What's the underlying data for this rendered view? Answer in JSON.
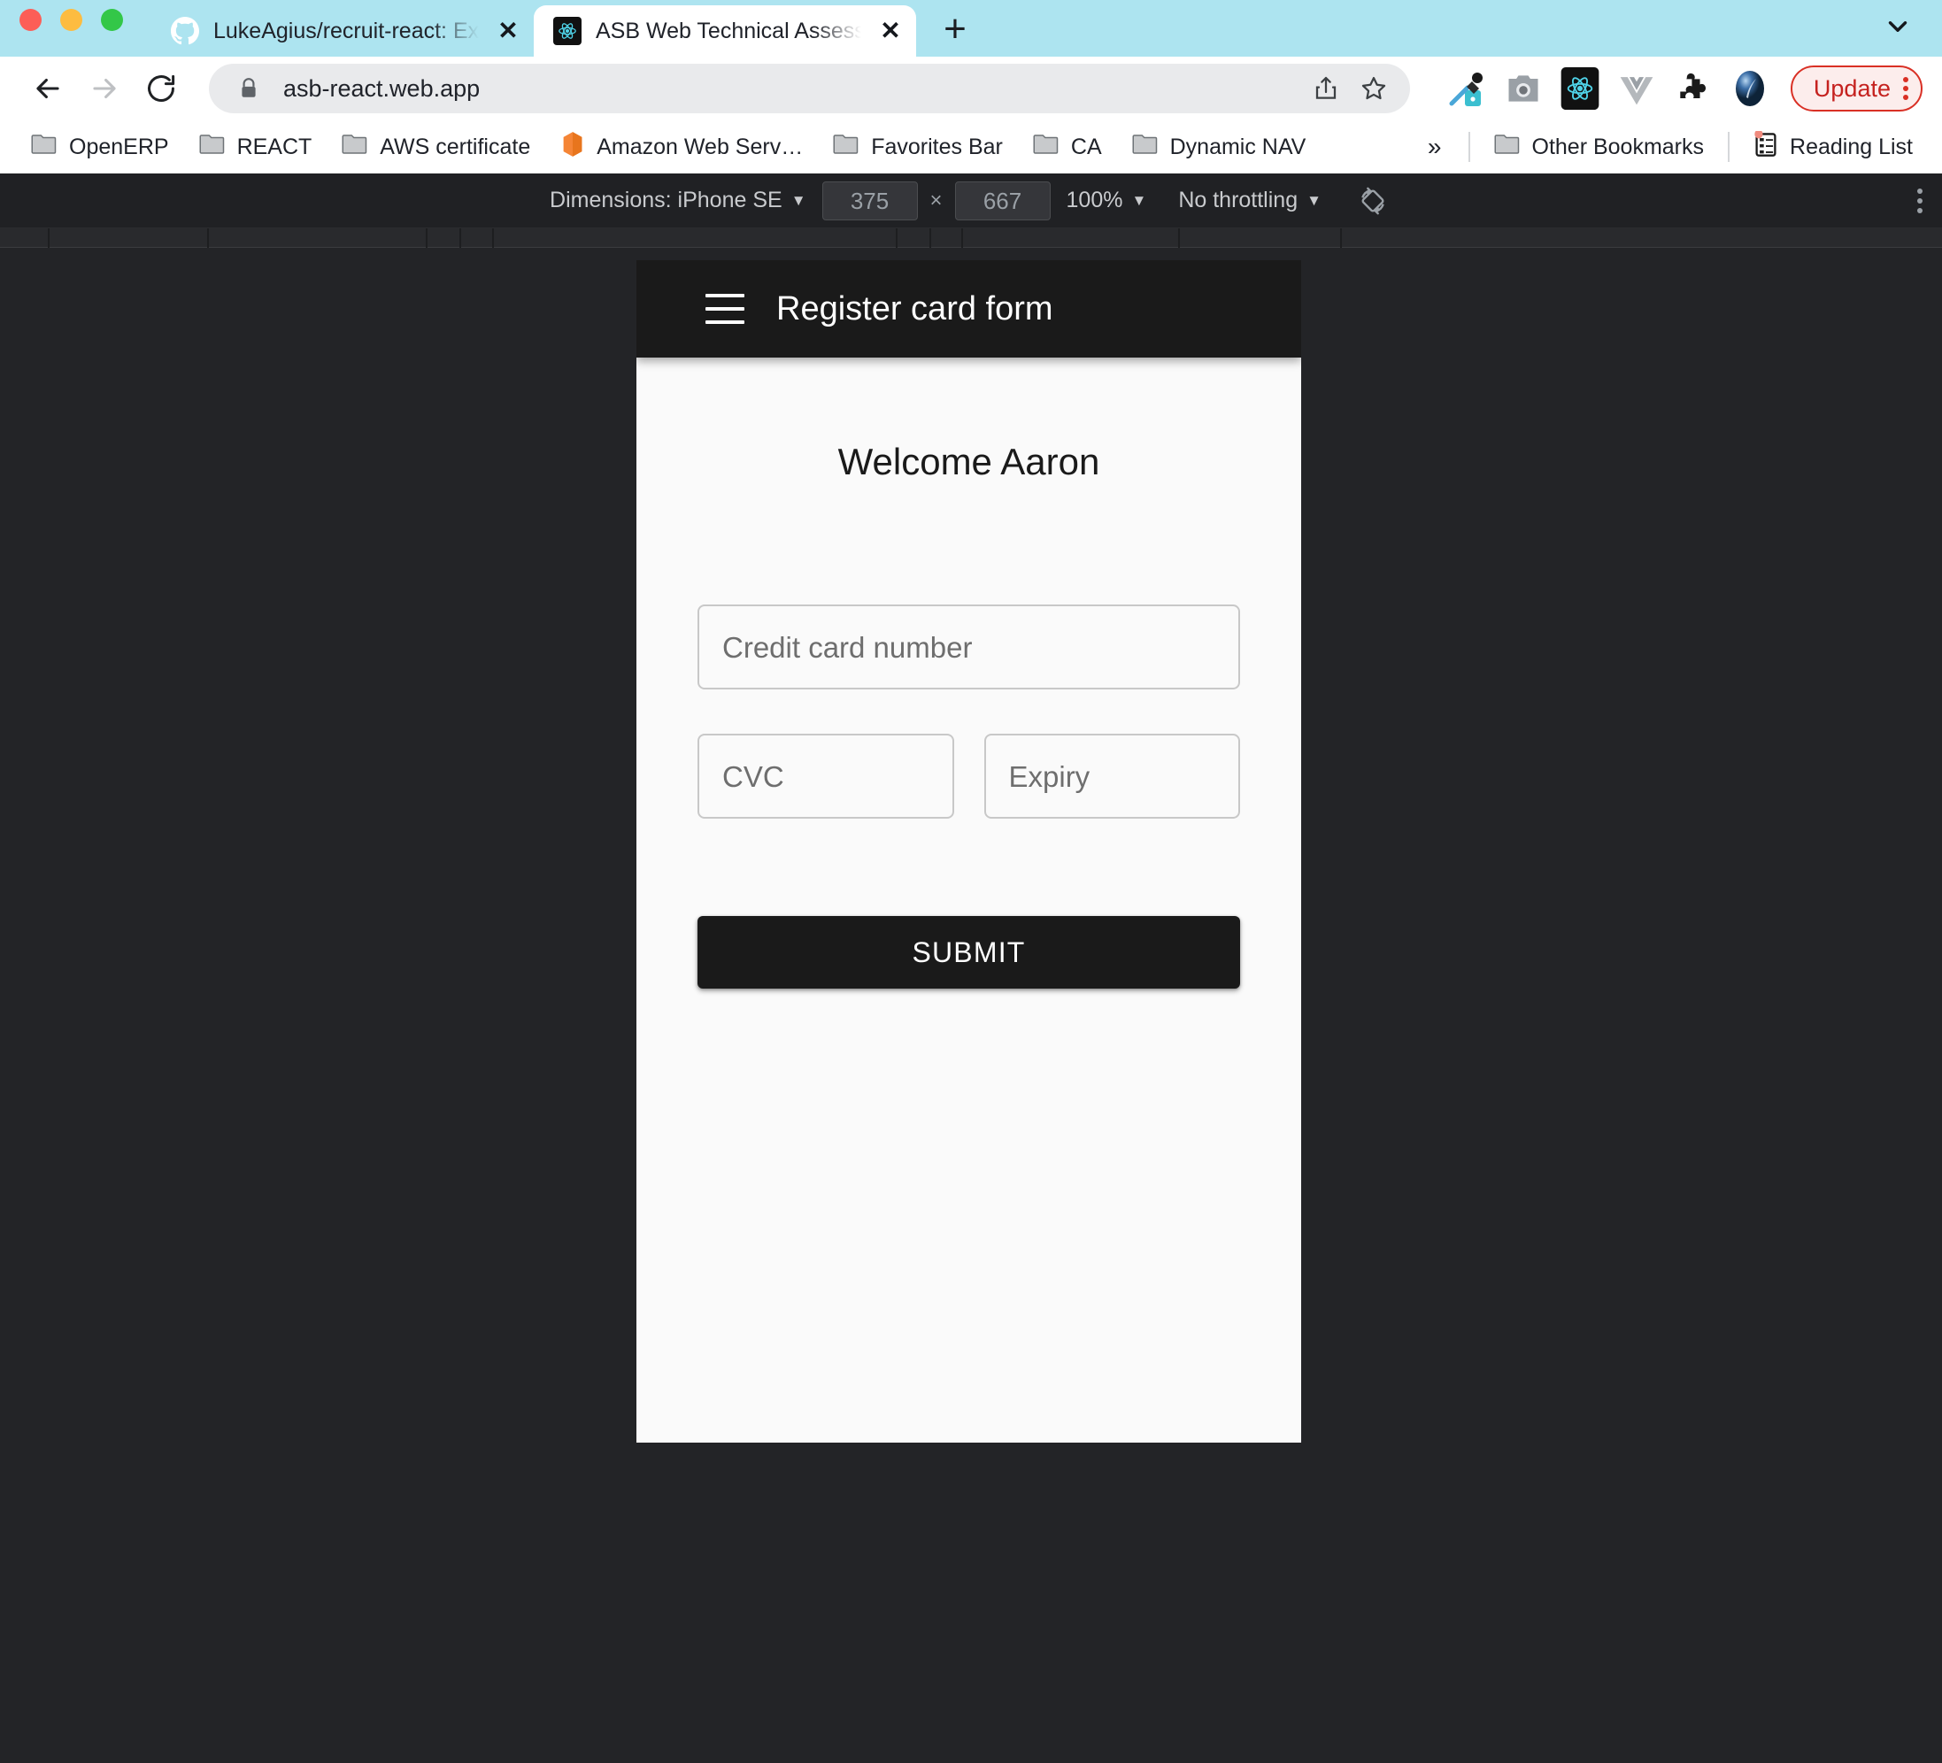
{
  "browser": {
    "window_controls": [
      "close",
      "minimize",
      "maximize"
    ],
    "tabs": [
      {
        "title": "LukeAgius/recruit-react: Examp",
        "favicon": "github-icon",
        "active": false,
        "close_label": "✕"
      },
      {
        "title": "ASB Web Technical Assessmen",
        "favicon": "react-icon",
        "active": true,
        "close_label": "✕"
      }
    ],
    "new_tab_label": "+",
    "tab_list_chevron": "chevron-down-icon",
    "omnibox": {
      "url": "asb-react.web.app",
      "lock_icon": "lock-icon",
      "share_icon": "share-icon",
      "bookmark_icon": "star-icon"
    },
    "extensions": [
      "eyedropper-icon",
      "camera-icon",
      "react-devtools-icon",
      "vue-devtools-icon",
      "puzzle-piece-icon",
      "profile-avatar-icon"
    ],
    "update_button": {
      "label": "Update",
      "color": "#D93025"
    },
    "bookmarks": [
      {
        "label": "OpenERP",
        "icon": "folder-icon"
      },
      {
        "label": "REACT",
        "icon": "folder-icon"
      },
      {
        "label": "AWS certificate",
        "icon": "folder-icon"
      },
      {
        "label": "Amazon Web Serv…",
        "icon": "aws-icon"
      },
      {
        "label": "Favorites Bar",
        "icon": "folder-icon"
      },
      {
        "label": "CA",
        "icon": "folder-icon"
      },
      {
        "label": "Dynamic NAV",
        "icon": "folder-icon"
      }
    ],
    "bookmarks_overflow": "»",
    "other_bookmarks": {
      "label": "Other Bookmarks",
      "icon": "folder-icon"
    },
    "reading_list": {
      "label": "Reading List",
      "icon": "reading-list-icon"
    }
  },
  "devtools": {
    "dimensions_label": "Dimensions: iPhone SE",
    "width": "375",
    "height": "667",
    "multiply_symbol": "×",
    "zoom": "100%",
    "throttling": "No throttling",
    "rotate_icon": "rotate-device-icon",
    "more_options_icon": "kebab-menu-icon"
  },
  "app": {
    "appbar": {
      "menu_icon": "hamburger-menu-icon",
      "title": "Register card form"
    },
    "welcome": "Welcome Aaron",
    "fields": [
      {
        "name": "credit-card-number",
        "placeholder": "Credit card number",
        "value": ""
      },
      {
        "name": "cvc",
        "placeholder": "CVC",
        "value": ""
      },
      {
        "name": "expiry",
        "placeholder": "Expiry",
        "value": ""
      }
    ],
    "submit_label": "SUBMIT"
  }
}
